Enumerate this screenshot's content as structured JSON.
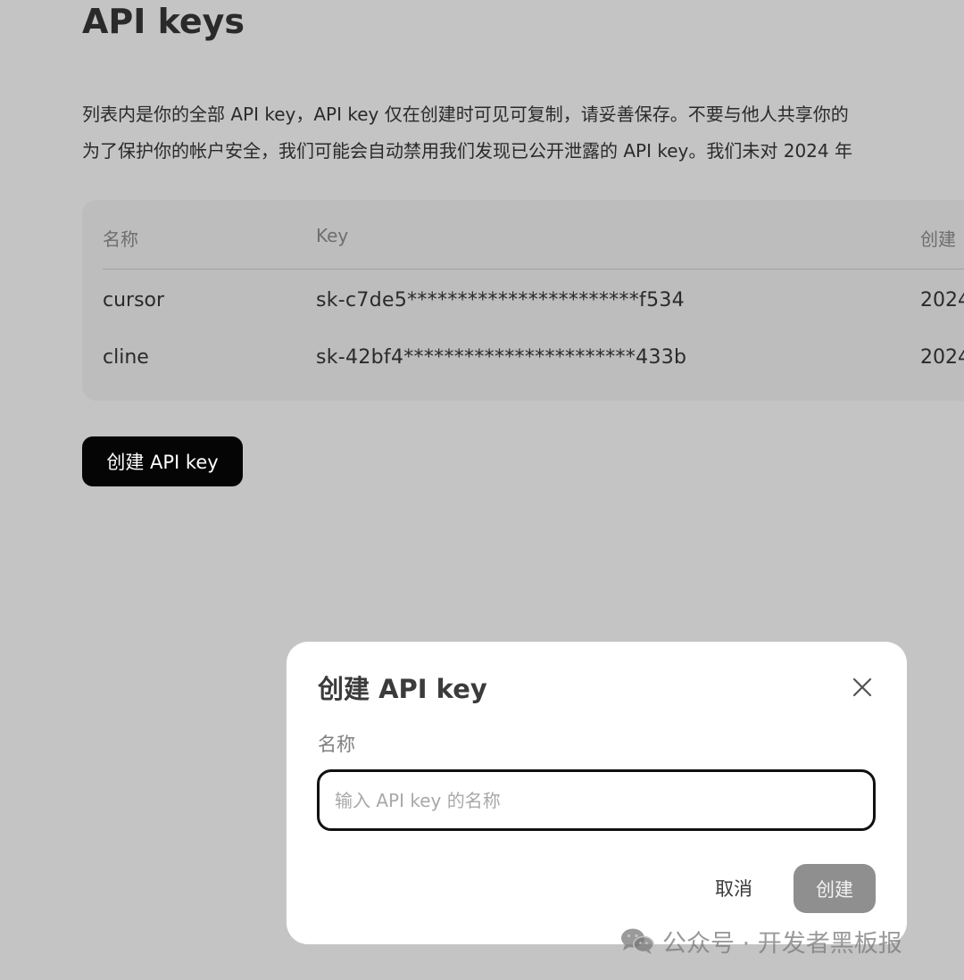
{
  "page": {
    "title": "API keys",
    "description_line1": "列表内是你的全部 API key，API key 仅在创建时可见可复制，请妥善保存。不要与他人共享你的",
    "description_line2": "为了保护你的帐户安全，我们可能会自动禁用我们发现已公开泄露的 API key。我们未对 2024 年"
  },
  "table": {
    "headers": {
      "name": "名称",
      "key": "Key",
      "created": "创建"
    },
    "rows": [
      {
        "name": "cursor",
        "key": "sk-c7de5***********************f534",
        "created": "2024"
      },
      {
        "name": "cline",
        "key": "sk-42bf4***********************433b",
        "created": "2024"
      }
    ]
  },
  "create_button_label": "创建 API key",
  "modal": {
    "title": "创建 API key",
    "close_icon": "close-icon",
    "name_label": "名称",
    "name_input_value": "",
    "name_input_placeholder": "输入 API key 的名称",
    "cancel_label": "取消",
    "submit_label": "创建"
  },
  "watermark": {
    "text": "公众号 · 开发者黑板报",
    "icon": "wechat-icon"
  },
  "colors": {
    "overlay_background": "#c4c4c4",
    "table_card_background": "#bdbdbd",
    "primary_button": "#050505",
    "submit_disabled": "#8f8f8f",
    "modal_background": "#ffffff"
  }
}
